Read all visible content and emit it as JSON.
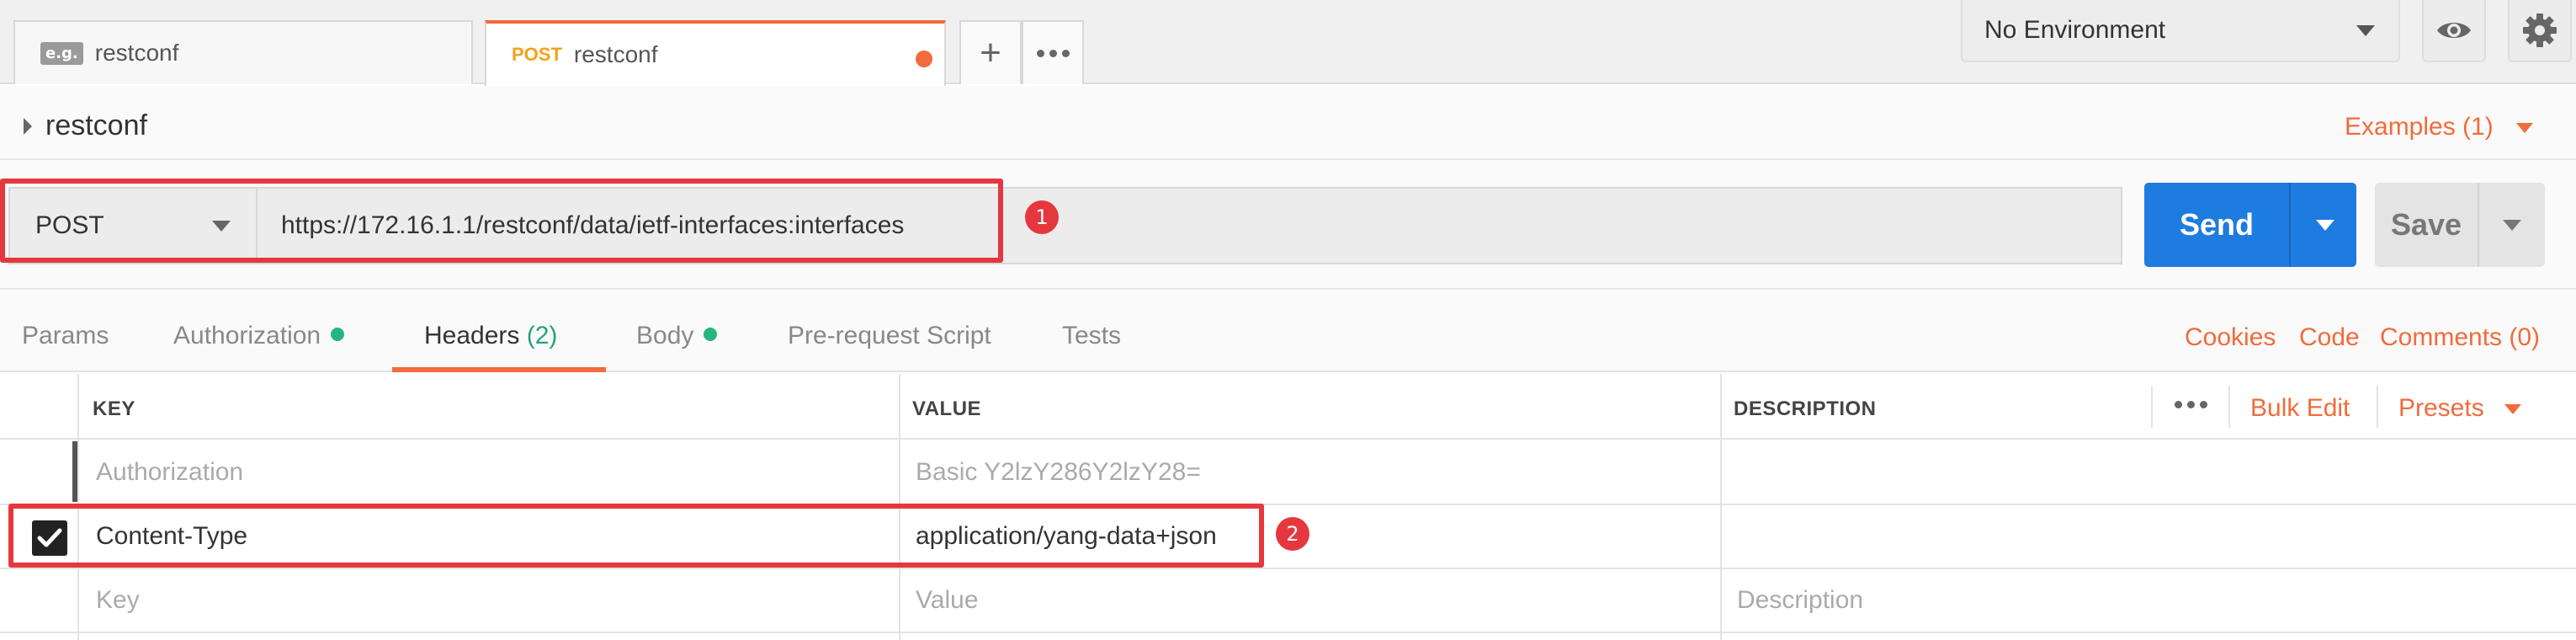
{
  "tabs": [
    {
      "badge": "e.g.",
      "label": "restconf"
    },
    {
      "method": "POST",
      "label": "restconf",
      "unsaved": true
    }
  ],
  "tab_actions": {
    "new_tab": "+",
    "more": "more-icon"
  },
  "environment": {
    "selected": "No Environment"
  },
  "request": {
    "name": "restconf",
    "examples": "Examples (1)",
    "method": "POST",
    "url": "https://172.16.1.1/restconf/data/ietf-interfaces:interfaces",
    "send_label": "Send",
    "save_label": "Save"
  },
  "request_tabs": {
    "params": "Params",
    "authorization": "Authorization",
    "headers": "Headers",
    "headers_count": "(2)",
    "body": "Body",
    "prerequest": "Pre-request Script",
    "tests": "Tests"
  },
  "request_links": {
    "cookies": "Cookies",
    "code": "Code",
    "comments": "Comments (0)"
  },
  "headers_table": {
    "columns": {
      "key": "KEY",
      "value": "VALUE",
      "description": "DESCRIPTION"
    },
    "bulk_edit": "Bulk Edit",
    "presets": "Presets",
    "rows": [
      {
        "key": "Authorization",
        "value": "Basic Y2lzY286Y2lzY28=",
        "enabled": false
      },
      {
        "key": "Content-Type",
        "value": "application/yang-data+json",
        "enabled": true
      }
    ],
    "placeholder": {
      "key": "Key",
      "value": "Value",
      "description": "Description"
    }
  },
  "annotations": {
    "first": "1",
    "second": "2"
  },
  "colors": {
    "accent": "#f26b3a",
    "send": "#1e7be0",
    "annotation": "#e5383e",
    "indicator": "#26b57f"
  }
}
